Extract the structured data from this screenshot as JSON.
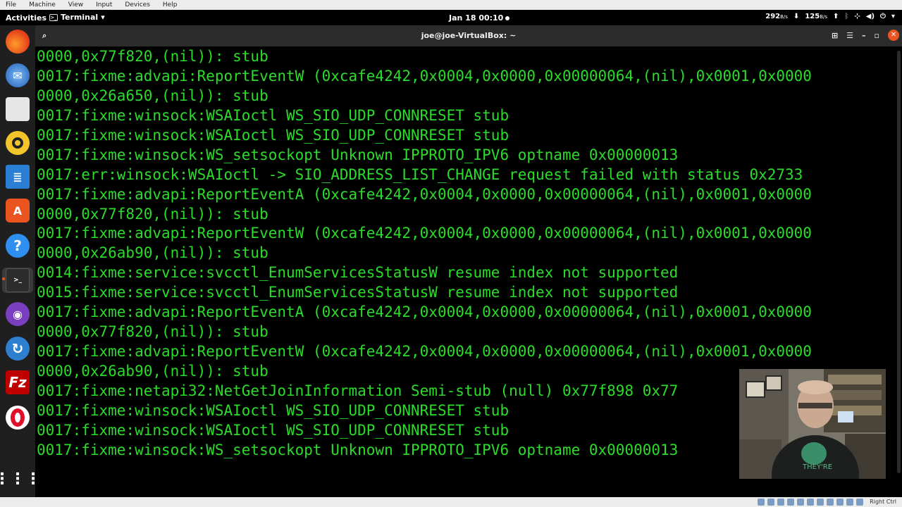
{
  "vbox_menu": [
    "File",
    "Machine",
    "View",
    "Input",
    "Devices",
    "Help"
  ],
  "topbar": {
    "activities": "Activities",
    "app_name": "Terminal",
    "clock": "Jan 18  00:10",
    "net_down": "292",
    "net_down_unit": "B/s",
    "net_up": "125",
    "net_up_unit": "B/s"
  },
  "window": {
    "title": "joe@joe-VirtualBox: ~"
  },
  "terminal": {
    "lines": [
      "0000,0x77f820,(nil)): stub",
      "0017:fixme:advapi:ReportEventW (0xcafe4242,0x0004,0x0000,0x00000064,(nil),0x0001,0x0000",
      "0000,0x26a650,(nil)): stub",
      "0017:fixme:winsock:WSAIoctl WS_SIO_UDP_CONNRESET stub",
      "0017:fixme:winsock:WSAIoctl WS_SIO_UDP_CONNRESET stub",
      "0017:fixme:winsock:WS_setsockopt Unknown IPPROTO_IPV6 optname 0x00000013",
      "0017:err:winsock:WSAIoctl -> SIO_ADDRESS_LIST_CHANGE request failed with status 0x2733",
      "0017:fixme:advapi:ReportEventA (0xcafe4242,0x0004,0x0000,0x00000064,(nil),0x0001,0x0000",
      "0000,0x77f820,(nil)): stub",
      "0017:fixme:advapi:ReportEventW (0xcafe4242,0x0004,0x0000,0x00000064,(nil),0x0001,0x0000",
      "0000,0x26ab90,(nil)): stub",
      "0014:fixme:service:svcctl_EnumServicesStatusW resume index not supported",
      "0015:fixme:service:svcctl_EnumServicesStatusW resume index not supported",
      "0017:fixme:advapi:ReportEventA (0xcafe4242,0x0004,0x0000,0x00000064,(nil),0x0001,0x0000",
      "0000,0x77f820,(nil)): stub",
      "0017:fixme:advapi:ReportEventW (0xcafe4242,0x0004,0x0000,0x00000064,(nil),0x0001,0x0000",
      "0000,0x26ab90,(nil)): stub",
      "0017:fixme:netapi32:NetGetJoinInformation Semi-stub (null) 0x77f898 0x77",
      "0017:fixme:winsock:WSAIoctl WS_SIO_UDP_CONNRESET stub",
      "0017:fixme:winsock:WSAIoctl WS_SIO_UDP_CONNRESET stub",
      "0017:fixme:winsock:WS_setsockopt Unknown IPPROTO_IPV6 optname 0x00000013"
    ]
  },
  "dock": [
    {
      "name": "firefox-icon",
      "color": "#ff7139"
    },
    {
      "name": "thunderbird-icon",
      "color": "#3c84d8"
    },
    {
      "name": "files-icon",
      "color": "#e8e8e8"
    },
    {
      "name": "rhythmbox-icon",
      "color": "#f0c020"
    },
    {
      "name": "writer-icon",
      "color": "#2a7fd4"
    },
    {
      "name": "software-icon",
      "color": "#e95420"
    },
    {
      "name": "help-icon",
      "color": "#2f8ff0"
    },
    {
      "name": "terminal-icon",
      "color": "#2c2c2c"
    },
    {
      "name": "podcast-icon",
      "color": "#7a3fc0"
    },
    {
      "name": "sync-icon",
      "color": "#2f7fd0"
    },
    {
      "name": "filezilla-icon",
      "color": "#bf0000"
    },
    {
      "name": "opera-icon",
      "color": "#e0102a"
    },
    {
      "name": "show-apps-icon",
      "color": "#ffffff"
    }
  ],
  "statusbar": {
    "host_key": "Right Ctrl"
  },
  "colors": {
    "terminal_text": "#2bdc2b",
    "accent": "#e95420"
  }
}
